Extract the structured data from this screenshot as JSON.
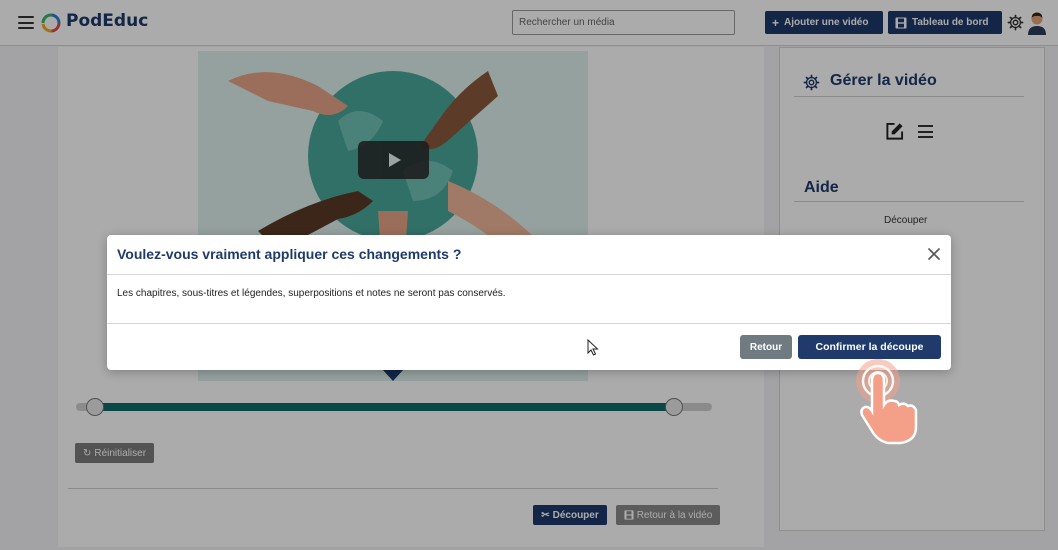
{
  "header": {
    "brand": "PodEduc",
    "search_placeholder": "Rechercher un média",
    "add_video_label": "Ajouter une vidéo",
    "dashboard_label": "Tableau de bord"
  },
  "editor": {
    "reset_label": "Réinitialiser",
    "cut_label": "Découper",
    "back_to_video_label": "Retour à la vidéo",
    "trim": {
      "start_fraction": 0.03,
      "end_fraction": 0.94
    }
  },
  "sidebar": {
    "title": "Gérer la vidéo",
    "help_title": "Aide",
    "help_items": [
      "Découper"
    ]
  },
  "modal": {
    "title": "Voulez-vous vraiment appliquer ces changements ?",
    "body": "Les chapitres, sous-titres et légendes, superpositions et notes ne seront pas conservés.",
    "back_label": "Retour",
    "confirm_label": "Confirmer la découpe"
  },
  "colors": {
    "primary": "#1f3a6b",
    "secondary_button": "#6f7b81",
    "track_fill": "#0f6a6a",
    "hand_overlay": "#f4a089"
  }
}
